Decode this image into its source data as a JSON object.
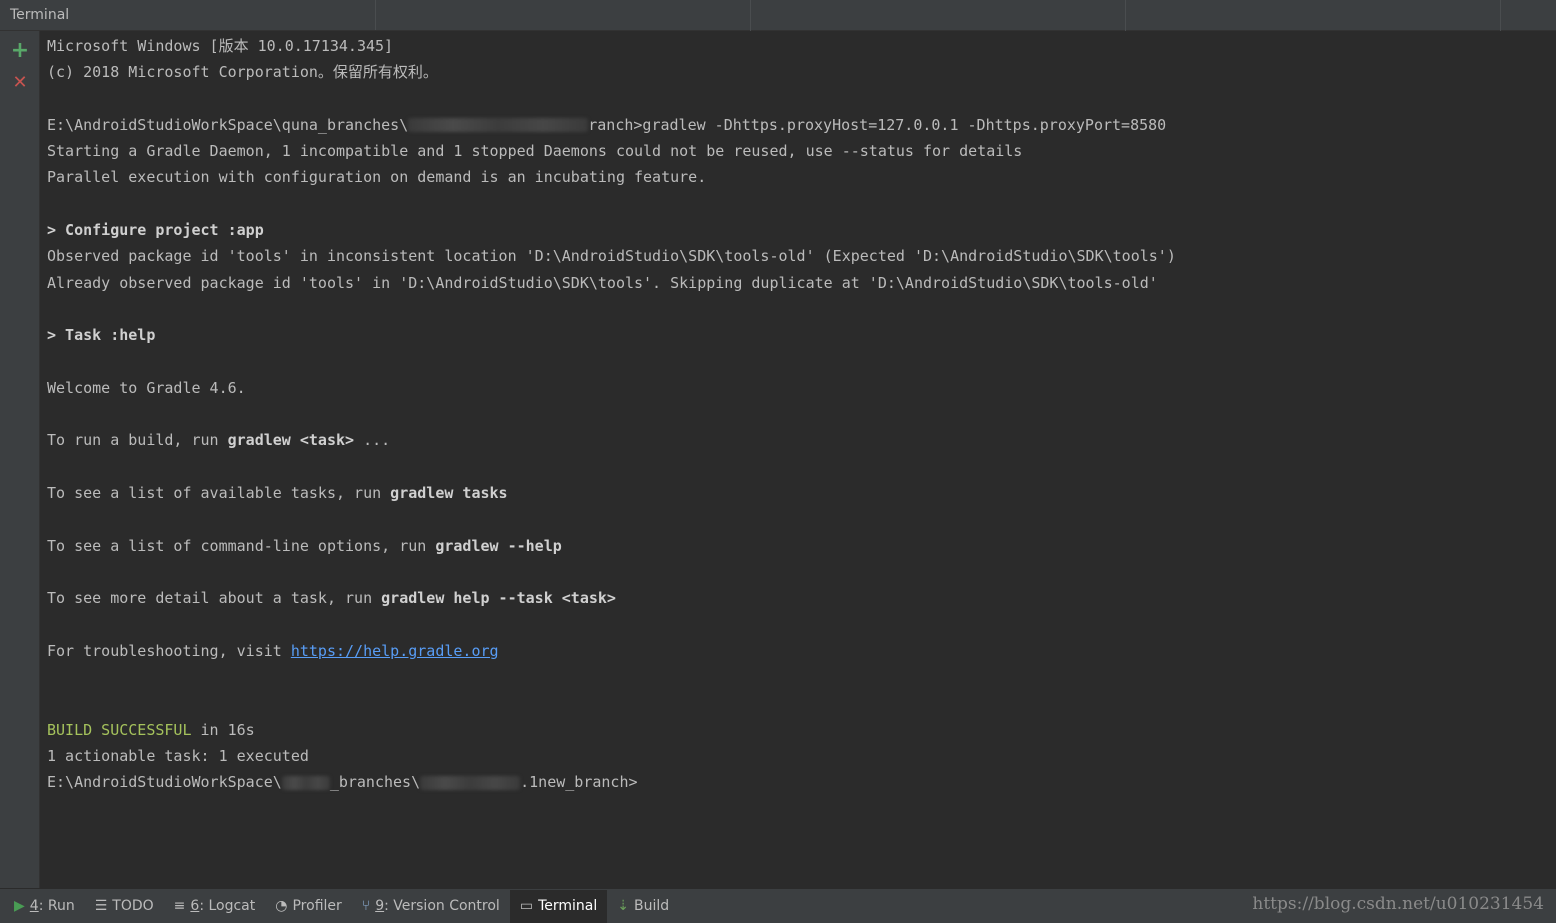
{
  "window": {
    "title": "Terminal"
  },
  "sidebar": {
    "add_icon": "+",
    "close_icon": "✕"
  },
  "terminal": {
    "lines": [
      {
        "t": "Microsoft Windows [版本 10.0.17134.345]"
      },
      {
        "t": "(c) 2018 Microsoft Corporation。保留所有权利。"
      },
      {
        "t": ""
      },
      {
        "pre": "E:\\AndroidStudioWorkSpace\\quna_branches\\",
        "post": "ranch>gradlew -Dhttps.proxyHost=127.0.0.1 -Dhttps.proxyPort=8580"
      },
      {
        "t": "Starting a Gradle Daemon, 1 incompatible and 1 stopped Daemons could not be reused, use --status for details"
      },
      {
        "t": "Parallel execution with configuration on demand is an incubating feature."
      },
      {
        "t": ""
      },
      {
        "b": "> Configure project :app"
      },
      {
        "t": "Observed package id 'tools' in inconsistent location 'D:\\AndroidStudio\\SDK\\tools-old' (Expected 'D:\\AndroidStudio\\SDK\\tools')"
      },
      {
        "t": "Already observed package id 'tools' in 'D:\\AndroidStudio\\SDK\\tools'. Skipping duplicate at 'D:\\AndroidStudio\\SDK\\tools-old'"
      },
      {
        "t": ""
      },
      {
        "b": "> Task :help"
      },
      {
        "t": ""
      },
      {
        "t": "Welcome to Gradle 4.6."
      },
      {
        "t": ""
      },
      {
        "t": "To run a build, run ",
        "b2": "gradlew <task>",
        "t2": " ..."
      },
      {
        "t": ""
      },
      {
        "t": "To see a list of available tasks, run ",
        "b2": "gradlew tasks"
      },
      {
        "t": ""
      },
      {
        "t": "To see a list of command-line options, run ",
        "b2": "gradlew --help"
      },
      {
        "t": ""
      },
      {
        "t": "To see more detail about a task, run ",
        "b2": "gradlew help --task <task>"
      },
      {
        "t": ""
      },
      {
        "t": "For troubleshooting, visit ",
        "link": "https://help.gradle.org"
      },
      {
        "t": ""
      },
      {
        "t": ""
      },
      {
        "g": "BUILD SUCCESSFUL",
        "t2": " in 16s"
      },
      {
        "t": "1 actionable task: 1 executed"
      },
      {
        "pre": "E:\\AndroidStudioWorkSpace\\",
        "mid": "_branches\\",
        "post": ".1new_branch>"
      }
    ]
  },
  "statusbar": {
    "tabs": [
      {
        "key": "4",
        "label": ": Run",
        "icon": "run-icon",
        "glyph": "▶",
        "color": "#499c54",
        "active": false
      },
      {
        "key": "",
        "label": "TODO",
        "icon": "todo-icon",
        "glyph": "☰",
        "color": "#bbbbbb",
        "active": false
      },
      {
        "key": "6",
        "label": ": Logcat",
        "icon": "logcat-icon",
        "glyph": "≡",
        "color": "#bbbbbb",
        "active": false
      },
      {
        "key": "",
        "label": "Profiler",
        "icon": "profiler-icon",
        "glyph": "◔",
        "color": "#bbbbbb",
        "active": false
      },
      {
        "key": "9",
        "label": ": Version Control",
        "icon": "version-control-icon",
        "glyph": "⑂",
        "color": "#8fb0d6",
        "active": false
      },
      {
        "key": "",
        "label": "Terminal",
        "icon": "terminal-icon",
        "glyph": "▭",
        "color": "#bbbbbb",
        "active": true
      },
      {
        "key": "",
        "label": "Build",
        "icon": "build-icon",
        "glyph": "⇣",
        "color": "#6a9f5b",
        "active": false
      }
    ],
    "watermark": "https://blog.csdn.net/u010231454"
  }
}
